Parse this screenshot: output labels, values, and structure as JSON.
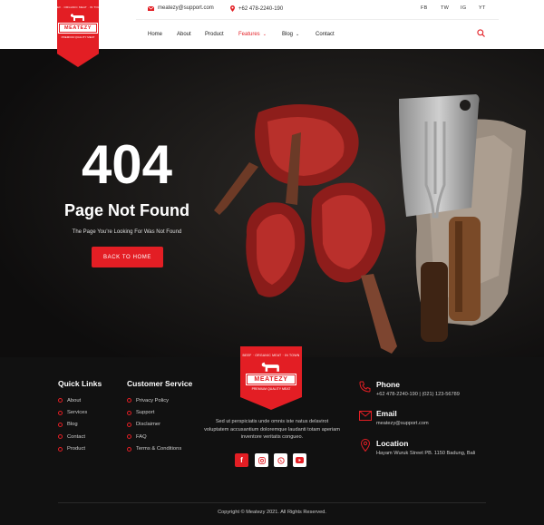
{
  "brand": {
    "name": "MEATEZY",
    "tagline_top": "BEEF · ORGANIC MEAT · IN TOWN",
    "tagline_bottom": "PREMIUM QUALITY MEAT",
    "accent": "#e31e24"
  },
  "topbar": {
    "email": "meatezy@support.com",
    "phone": "+62 478-2240-190",
    "social": [
      "FB",
      "TW",
      "IG",
      "YT"
    ]
  },
  "nav": {
    "items": [
      {
        "label": "Home"
      },
      {
        "label": "About"
      },
      {
        "label": "Product"
      },
      {
        "label": "Features",
        "active": true
      },
      {
        "label": "Blog"
      },
      {
        "label": "Contact"
      }
    ]
  },
  "hero": {
    "code": "404",
    "title": "Page Not Found",
    "subtitle": "The Page You're Looking For Was Not Found",
    "button": "BACK TO HOME"
  },
  "footer": {
    "quick_links": {
      "heading": "Quick Links",
      "items": [
        "About",
        "Services",
        "Blog",
        "Contact",
        "Product"
      ]
    },
    "customer_service": {
      "heading": "Customer Service",
      "items": [
        "Privacy Policy",
        "Support",
        "Disclaimer",
        "FAQ",
        "Terms & Conditions"
      ]
    },
    "description": "Sed ut perspiciatis unde omnis iste natus delavirot voluptatem accusantium doloremque laudanti totam aperiam inventore veritatis congueo.",
    "social_icons": [
      "facebook-icon",
      "instagram-icon",
      "whatsapp-icon",
      "youtube-icon"
    ],
    "contact": {
      "phone_title": "Phone",
      "phone_text": "+62 478-2240-190 | (021) 123-56789",
      "email_title": "Email",
      "email_text": "meatezy@support.com",
      "location_title": "Location",
      "location_text": "Hayam Wuruk Street PB. 1150 Badung, Bali"
    },
    "copyright": "Copyright © Meatezy 2021. All Rights Reserved."
  }
}
